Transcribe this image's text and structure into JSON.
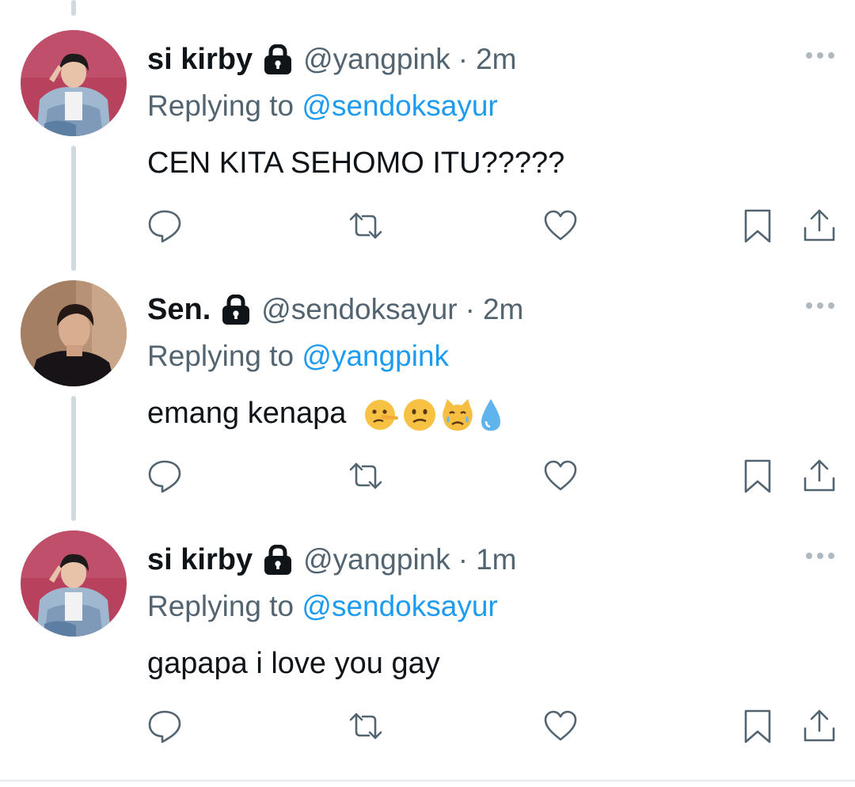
{
  "tweets": [
    {
      "display_name": "si kirby",
      "handle": "@yangpink",
      "time": "2m",
      "replying_label": "Replying to",
      "replying_to": "@sendoksayur",
      "text": "CEN KITA SEHOMO ITU?????",
      "avatar": "kirby-avatar",
      "emojis": []
    },
    {
      "display_name": "Sen.",
      "handle": "@sendoksayur",
      "time": "2m",
      "replying_label": "Replying to",
      "replying_to": "@yangpink",
      "text": "emang kenapa",
      "avatar": "sen-avatar",
      "emojis": [
        "lying-face-emoji",
        "confused-face-emoji",
        "crying-cat-emoji",
        "droplet-emoji"
      ]
    },
    {
      "display_name": "si kirby",
      "handle": "@yangpink",
      "time": "1m",
      "replying_label": "Replying to",
      "replying_to": "@sendoksayur",
      "text": "gapapa i love you gay",
      "avatar": "kirby-avatar",
      "emojis": []
    }
  ],
  "separator": "·",
  "icons": {
    "reply": "reply-icon",
    "retweet": "retweet-icon",
    "like": "like-icon",
    "bookmark": "bookmark-icon",
    "share": "share-icon",
    "lock": "lock-icon",
    "more": "more-icon"
  },
  "colors": {
    "text": "#0f1419",
    "secondary": "#536471",
    "accent": "#1d9bf0",
    "thread_line": "#cfd9de"
  }
}
